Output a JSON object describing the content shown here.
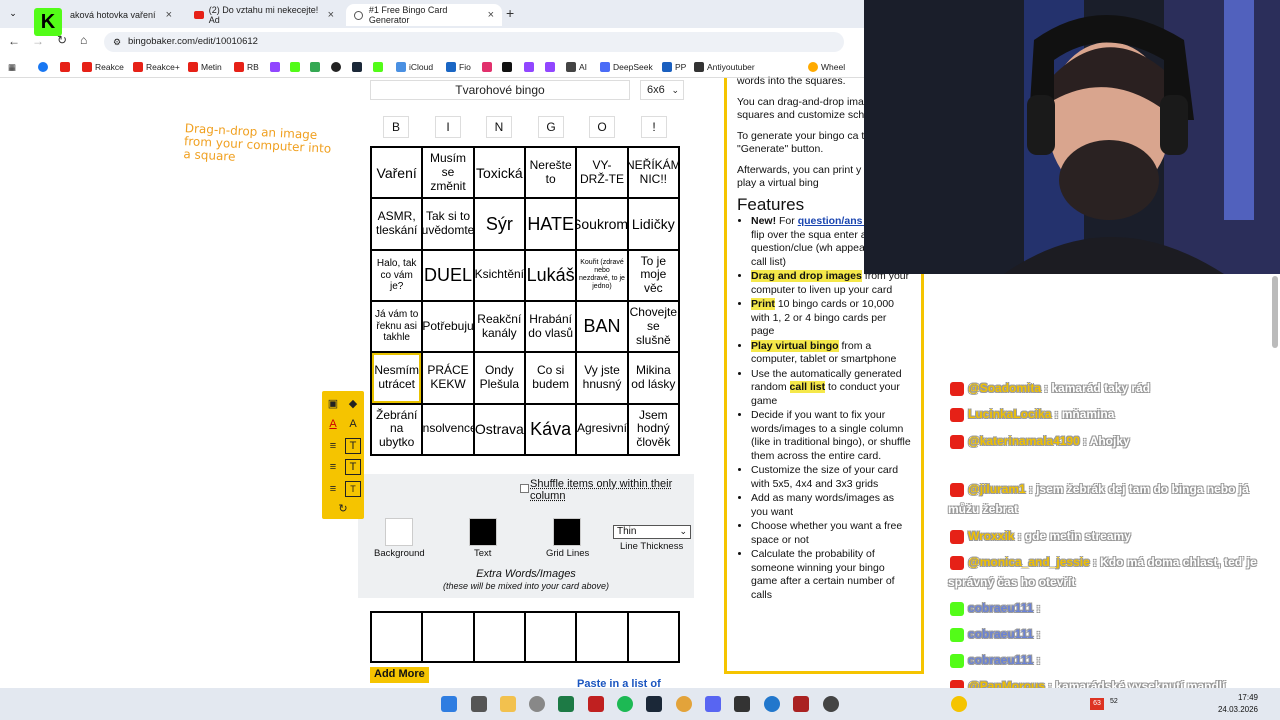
{
  "browser": {
    "tabs": [
      {
        "label": "aková hotovka vaření"
      },
      {
        "label": "(2) Do vztahu mi nekecejte! Ad"
      },
      {
        "label": "#1 Free Bingo Card Generator"
      }
    ],
    "url": "bingobaker.com/edit/10010612",
    "bookmarks": [
      {
        "label": "Reakce",
        "color": "#e62117"
      },
      {
        "label": "Reakce+",
        "color": "#e62117"
      },
      {
        "label": "Metin",
        "color": "#e62117"
      },
      {
        "label": "RB",
        "color": "#e62117"
      },
      {
        "label": "iCloud",
        "color": "#4a90e2"
      },
      {
        "label": "Fio",
        "color": "#1a66c4"
      },
      {
        "label": "AI",
        "color": "#444"
      },
      {
        "label": "DeepSeek",
        "color": "#4a6cf7"
      },
      {
        "label": "PP",
        "color": "#1a5fbf"
      },
      {
        "label": "Antiyoutuber",
        "color": "#333"
      },
      {
        "label": "Wheel",
        "color": "#ffaa00"
      }
    ]
  },
  "page": {
    "hint": "Drag-n-drop an image from your computer into a square",
    "card_title": "Tvarohové bingo",
    "size": "6x6",
    "headers": [
      "B",
      "I",
      "N",
      "G",
      "O",
      "!"
    ],
    "cells": [
      "Vaření",
      "Musím se změnit",
      "Toxická",
      "Nerešte to",
      "VY-DRŽ-TE",
      "NEŘÍKÁM NIC!!",
      "ASMR, tleskání",
      "Tak si to uvědomte",
      "Sýr",
      "HATE",
      "Soukromí",
      "Lidičky",
      "Halo, tak co vám je?",
      "DUEL",
      "Ksichtění",
      "Lukáš",
      "Kouřit (zdravé nebo nezdravé, to je jedno)",
      "To je moje věc",
      "Já vám to řeknu asi takhle",
      "Potřebuju",
      "Reakční kanály",
      "Hrabání do vlasů",
      "BAN",
      "Chovejte se slušně",
      "Nesmím utrácet",
      "PRÁCE KEKW",
      "Ondy Plešula",
      "Co si budem",
      "Vy jste hnusný",
      "Mikina od lásky",
      "Žebrání na ubytko",
      "Insolvence",
      "Ostrava",
      "Káva",
      "Agresivní",
      "Jsem hodný člověk"
    ],
    "shuffle_label": "Shuffle items only within their column",
    "background_label": "Background",
    "text_label": "Text",
    "gridlines_label": "Grid Lines",
    "thickness_value": "Thin",
    "thickness_label": "Line Thickness",
    "extra_title": "Extra Words/Images",
    "extra_sub": "(these will be mixed into your card above)",
    "add_more": "Add More",
    "paste": "Paste in a list of words",
    "colors": {
      "background": "#ffffff",
      "text": "#000000",
      "gridlines": "#000000",
      "accent": "#f5c400"
    }
  },
  "right": {
    "p0": "words into the squares.",
    "p1": "You can drag-and-drop ima the squares and customize scheme.",
    "p2": "To generate your bingo ca the \"Generate\" button.",
    "p3": "Afterwards, you can print y cards, or play a virtual bing",
    "features_heading": "Features",
    "f1_bold": "New!",
    "f1_a": " For ",
    "f1_link": "question/ans bingo,",
    "f1_b": " flip over the squa enter a question/clue (wh appear on the call list)",
    "f2_hl": "Drag and drop images",
    "f2": " from your computer to liven up your card",
    "f3_hl": "Print",
    "f3": " 10 bingo cards or 10,000 with 1, 2 or 4 bingo cards per page",
    "f4_hl": "Play virtual bingo",
    "f4": " from a computer, tablet or smartphone",
    "f5_a": "Use the automatically generated random ",
    "f5_hl": "call list",
    "f5_b": " to conduct your game",
    "f6": "Decide if you want to fix your words/images to a single column (like in traditional bingo), or shuffle them across the entire card.",
    "f7": "Customize the size of your card with 5x5, 4x4 and 3x3 grids",
    "f8": "Add as many words/images as you want",
    "f9": "Choose whether you want a free space or not",
    "f10": "Calculate the probability of someone winning your bingo game after a certain number of calls"
  },
  "chat": [
    {
      "user": "@Soadomita",
      "text": ": kamarád taky rád",
      "color": "#f0c000"
    },
    {
      "user": "LucinkaLocika",
      "text": ": mňamina",
      "color": "#f0c000"
    },
    {
      "user": "@katerinamala4190",
      "text": ": Ahojky",
      "color": "#f0c000"
    },
    {
      "user": "@jiluram1",
      "text": ": jsem žebrák dej tam do binga nebo já můžu žebrat",
      "color": "#f0c000"
    },
    {
      "user": "Wroxxik",
      "text": ": gde metin streamy",
      "color": "#f0c000"
    },
    {
      "user": "@monica_and_jessie",
      "text": ": Kdo má doma chlast, teď je správný čas ho otevřít",
      "color": "#f0c000"
    },
    {
      "user": "cobraeu111",
      "text": ":",
      "color": "#6a82d6"
    },
    {
      "user": "cobraeu111",
      "text": ":",
      "color": "#6a82d6"
    },
    {
      "user": "cobraeu111",
      "text": ":",
      "color": "#6a82d6"
    },
    {
      "user": "@PanMorous",
      "text": ": kamarádské vyseknutí mandlí",
      "color": "#f0c000"
    }
  ],
  "taskbar": {
    "time": "17:49",
    "date": "24.03.2026",
    "badge1": "63",
    "badge2": "52"
  }
}
